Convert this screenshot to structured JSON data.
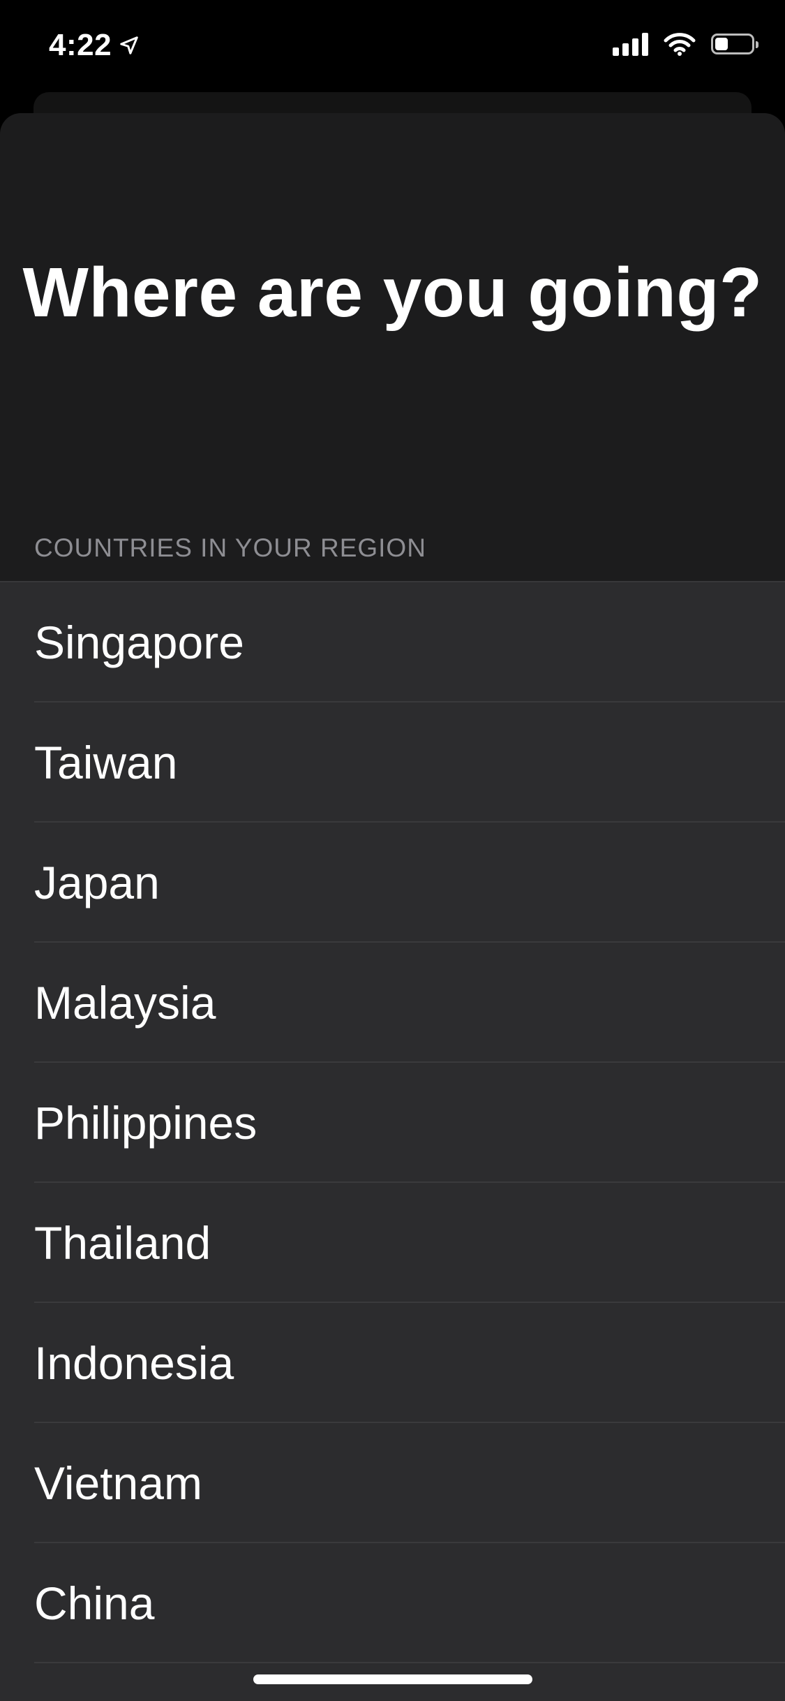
{
  "status_bar": {
    "time": "4:22",
    "location_icon": "location-arrow-icon",
    "signal_icon": "cellular-signal-icon",
    "wifi_icon": "wifi-icon",
    "battery_icon": "battery-icon",
    "battery_level": 0.35
  },
  "title": "Where are you going?",
  "section_header": "COUNTRIES IN YOUR REGION",
  "countries": [
    "Singapore",
    "Taiwan",
    "Japan",
    "Malaysia",
    "Philippines",
    "Thailand",
    "Indonesia",
    "Vietnam",
    "China"
  ],
  "colors": {
    "background": "#000000",
    "sheet": "#1c1c1d",
    "list_background": "#2c2c2e",
    "secondary_text": "#8e8e93",
    "primary_text": "#ffffff"
  }
}
